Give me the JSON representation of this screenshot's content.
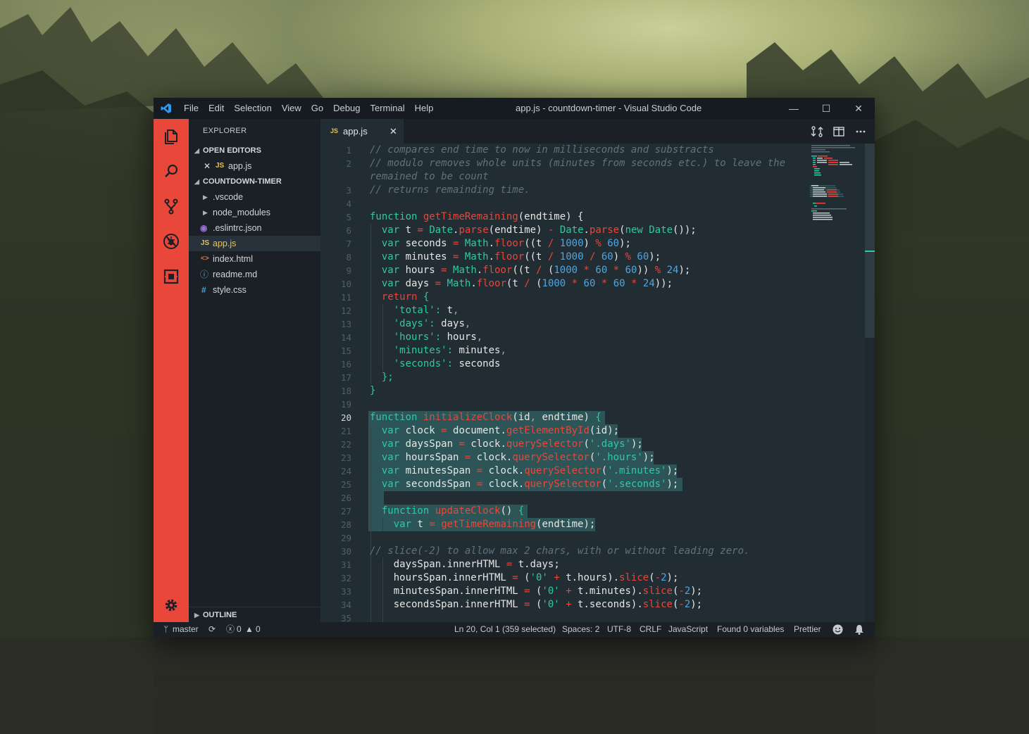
{
  "window": {
    "title": "app.js - countdown-timer - Visual Studio Code",
    "menu": [
      "File",
      "Edit",
      "Selection",
      "View",
      "Go",
      "Debug",
      "Terminal",
      "Help"
    ],
    "controls": {
      "minimize": "—",
      "maximize": "☐",
      "close": "✕"
    }
  },
  "activity_bar": {
    "color": "#e8473a",
    "icons": [
      "files-icon",
      "search-icon",
      "source-control-icon",
      "debug-icon",
      "extensions-icon",
      "gear-icon"
    ]
  },
  "sidebar": {
    "title": "EXPLORER",
    "open_editors": {
      "label": "OPEN EDITORS",
      "items": [
        {
          "icon": "JS",
          "name": "app.js"
        }
      ]
    },
    "project": {
      "label": "COUNTDOWN-TIMER",
      "items": [
        {
          "name": ".vscode",
          "kind": "folder"
        },
        {
          "name": "node_modules",
          "kind": "folder"
        },
        {
          "name": ".eslintrc.json",
          "kind": "eslint"
        },
        {
          "name": "app.js",
          "kind": "js",
          "icon": "JS"
        },
        {
          "name": "index.html",
          "kind": "html",
          "icon": "<>"
        },
        {
          "name": "readme.md",
          "kind": "md",
          "icon": "ⓘ"
        },
        {
          "name": "style.css",
          "kind": "css",
          "icon": "#"
        }
      ]
    },
    "outline_label": "OUTLINE"
  },
  "tab": {
    "icon": "JS",
    "name": "app.js",
    "close": "✕"
  },
  "editor": {
    "current_line": 20,
    "line_numbers": [
      "1",
      "2",
      "3",
      "4",
      "5",
      "6",
      "7",
      "8",
      "9",
      "10",
      "11",
      "12",
      "13",
      "14",
      "15",
      "16",
      "17",
      "18",
      "19",
      "20",
      "21",
      "22",
      "23",
      "24",
      "25",
      "26",
      "27",
      "28",
      "29",
      "30",
      "31",
      "32",
      "33",
      "34",
      "35"
    ]
  },
  "status": {
    "branch": "master",
    "errors": "0",
    "warnings": "0",
    "cursor": "Ln 20, Col 1 (359 selected)",
    "spaces": "Spaces: 2",
    "encoding": "UTF-8",
    "eol": "CRLF",
    "language": "JavaScript",
    "variables": "Found 0 variables",
    "formatter": "Prettier"
  }
}
